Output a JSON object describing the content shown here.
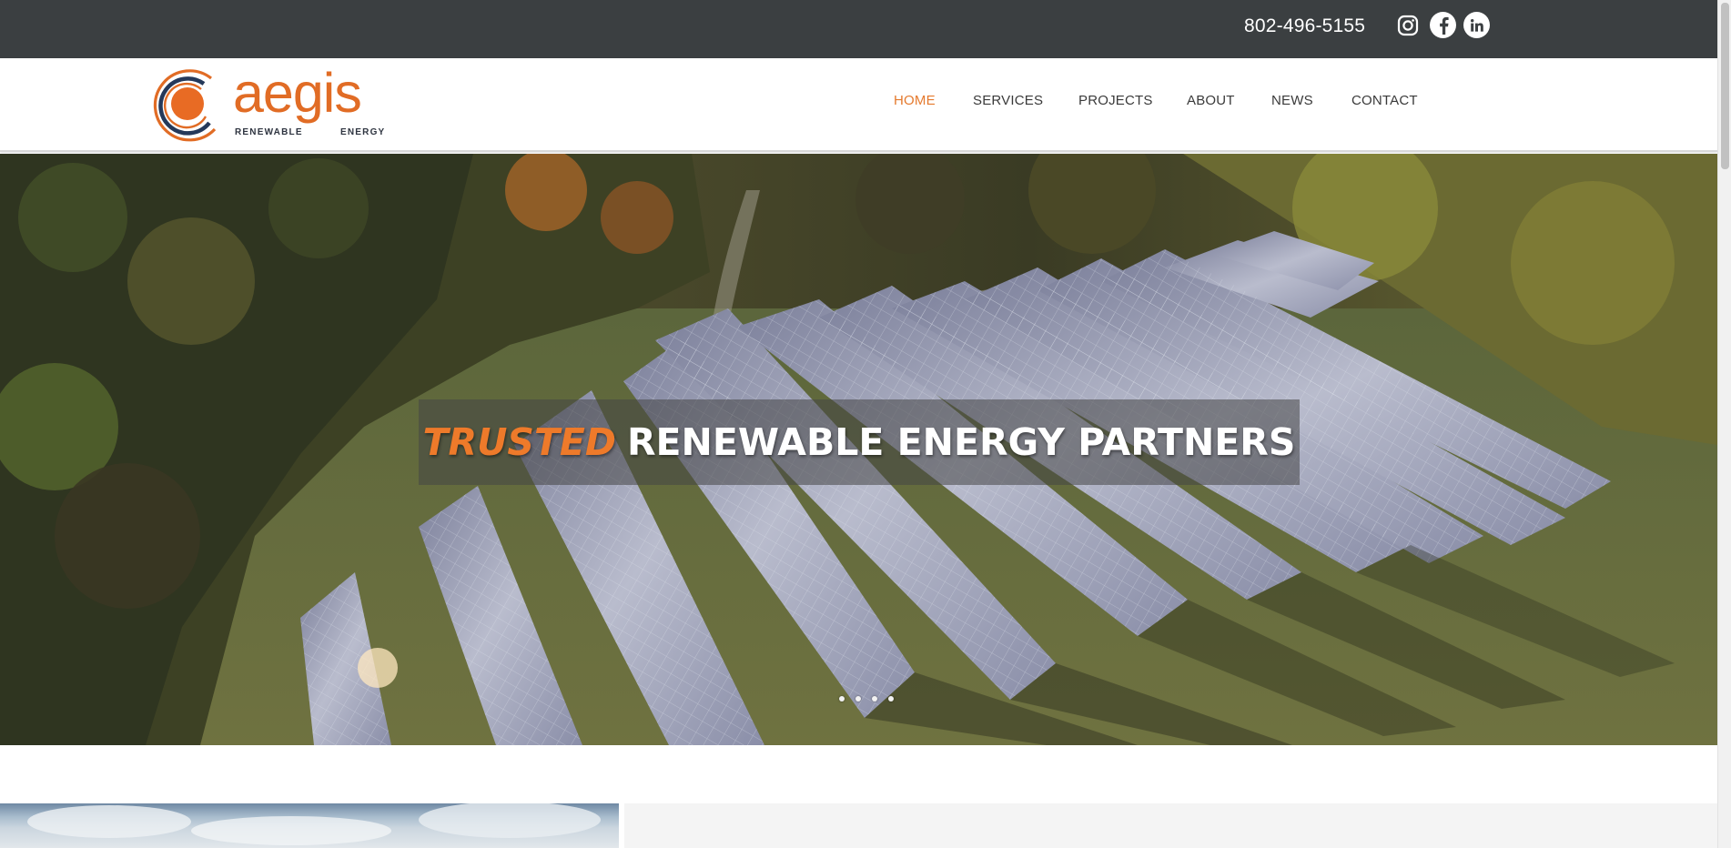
{
  "topbar": {
    "phone": "802-496-5155",
    "social": [
      {
        "name": "instagram",
        "icon": "instagram-icon"
      },
      {
        "name": "facebook",
        "icon": "facebook-icon"
      },
      {
        "name": "linkedin",
        "icon": "linkedin-icon"
      }
    ]
  },
  "logo": {
    "word": "aegis",
    "sub_left": "RENEWABLE",
    "sub_right": "ENERGY"
  },
  "nav": {
    "items": [
      {
        "label": "HOME",
        "active": true
      },
      {
        "label": "SERVICES",
        "active": false
      },
      {
        "label": "PROJECTS",
        "active": false
      },
      {
        "label": "ABOUT",
        "active": false
      },
      {
        "label": "NEWS",
        "active": false
      },
      {
        "label": "CONTACT",
        "active": false
      }
    ]
  },
  "hero": {
    "headline_accent": "TRUSTED",
    "headline_rest": "RENEWABLE ENERGY PARTNERS",
    "slide_count": 4
  },
  "colors": {
    "accent": "#e57a2e",
    "topbar": "#3b3f41",
    "text": "#3a3a3a"
  }
}
